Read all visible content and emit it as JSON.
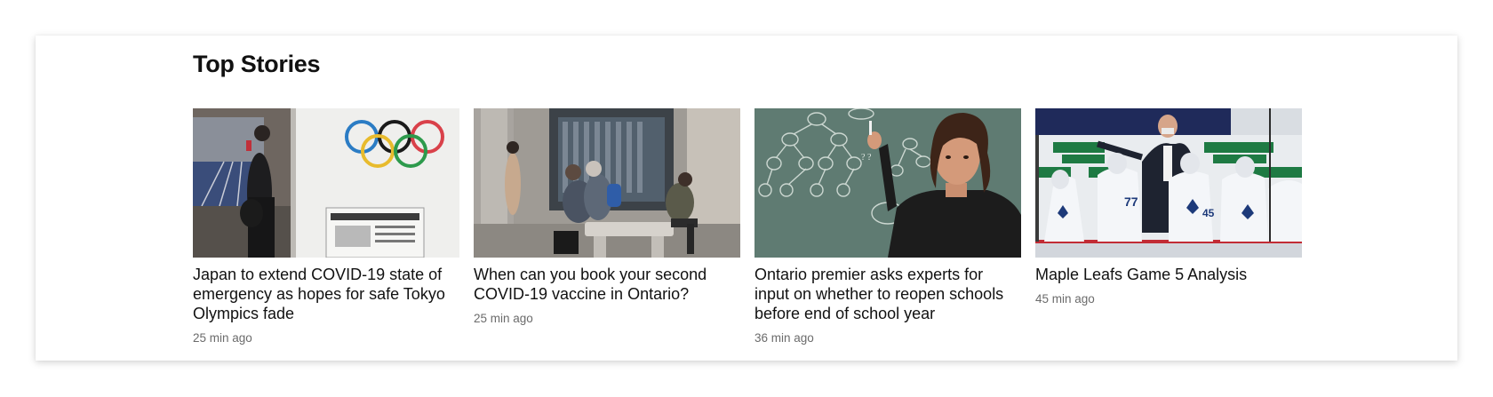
{
  "section": {
    "title": "Top Stories"
  },
  "stories": [
    {
      "headline": "Japan to extend COVID-19 state of emergency as hopes for safe Tokyo Olympics fade",
      "time": "25 min ago",
      "image_icon": "olympic-rings-photo"
    },
    {
      "headline": "When can you book your second COVID-19 vaccine in Ontario?",
      "time": "25 min ago",
      "image_icon": "street-bench-photo"
    },
    {
      "headline": "Ontario premier asks experts for input on whether to reopen schools before end of school year",
      "time": "36 min ago",
      "image_icon": "chalkboard-teacher-photo"
    },
    {
      "headline": "Maple Leafs Game 5 Analysis",
      "time": "45 min ago",
      "image_icon": "hockey-bench-photo"
    }
  ],
  "colors": {
    "text": "#111111",
    "timestamp": "#6b6b6b",
    "panel": "#ffffff"
  }
}
